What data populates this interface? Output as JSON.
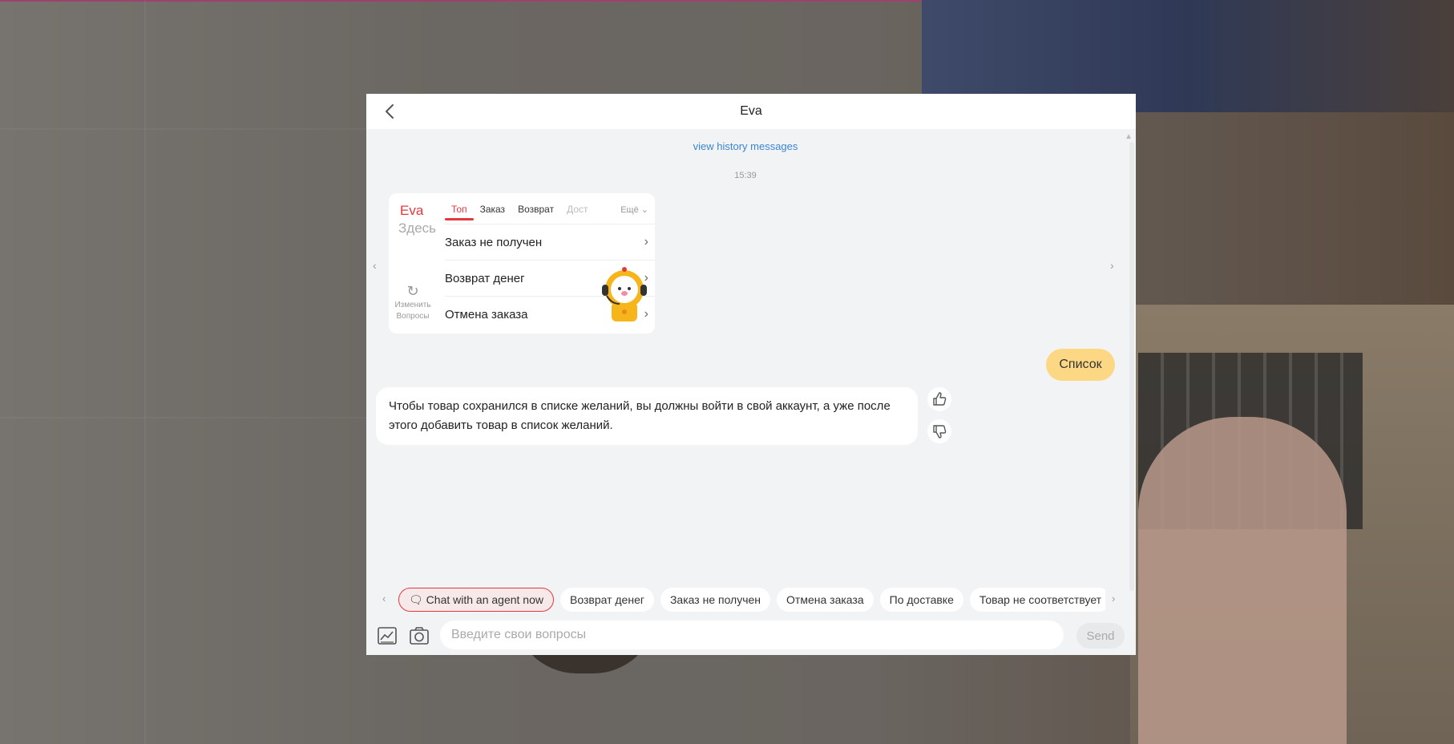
{
  "header": {
    "title": "Eva",
    "back_icon": "chevron-left-icon"
  },
  "messages": {
    "history_link": "view history messages",
    "timestamp": "15:39",
    "question_card": {
      "brand": "Eva",
      "subtitle": "Здесь",
      "refresh_label_1": "Изменить",
      "refresh_label_2": "Вопросы",
      "tabs": [
        "Топ",
        "Заказ",
        "Возврат",
        "Дост"
      ],
      "more": "Ещё",
      "items": [
        "Заказ не получен",
        "Возврат денег",
        "Отмена заказа"
      ]
    },
    "user_message": "Список",
    "bot_message": "Чтобы товар сохранился в списке желаний, вы должны войти в свой аккаунт, а уже после этого добавить товар в список желаний."
  },
  "quick_replies": {
    "agent_chip": "Chat with an agent now",
    "chips": [
      "Возврат денег",
      "Заказ не получен",
      "Отмена заказа",
      "По доставке",
      "Товар не соответствует"
    ]
  },
  "input": {
    "placeholder": "Введите свои вопросы",
    "value": "",
    "send_label": "Send"
  },
  "colors": {
    "accent": "#e4393c",
    "user_bubble": "#fcd884",
    "link": "#3a86d6"
  }
}
